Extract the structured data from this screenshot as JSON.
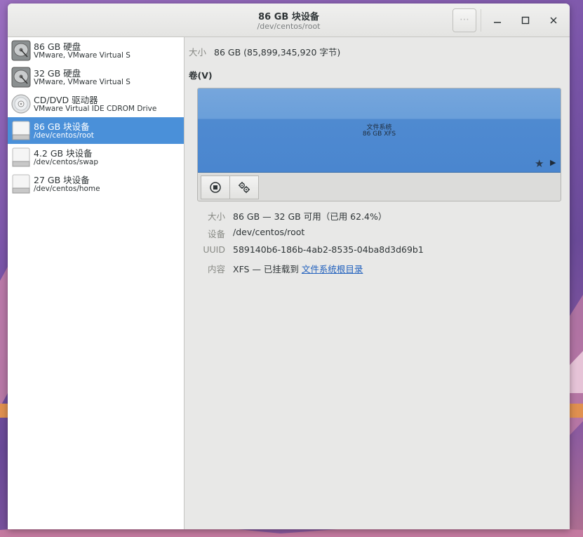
{
  "window": {
    "title": "86 GB 块设备",
    "subtitle": "/dev/centos/root",
    "menu_label": "⋯"
  },
  "sidebar": {
    "drives": [
      {
        "name": "86 GB 硬盘",
        "desc": "VMware, VMware Virtual S",
        "icon": "harddisk-icon",
        "selected": false
      },
      {
        "name": "32 GB 硬盘",
        "desc": "VMware, VMware Virtual S",
        "icon": "harddisk-icon",
        "selected": false
      },
      {
        "name": "CD/DVD 驱动器",
        "desc": "VMware Virtual IDE CDROM Drive",
        "icon": "optical-disc-icon",
        "selected": false
      },
      {
        "name": "86 GB 块设备",
        "desc": "/dev/centos/root",
        "icon": "block-device-icon",
        "selected": true
      },
      {
        "name": "4.2 GB 块设备",
        "desc": "/dev/centos/swap",
        "icon": "block-device-icon",
        "selected": false
      },
      {
        "name": "27 GB 块设备",
        "desc": "/dev/centos/home",
        "icon": "block-device-icon",
        "selected": false
      }
    ]
  },
  "main": {
    "size_label": "大小",
    "size_value": "86 GB (85,899,345,920 字节)",
    "volumes_heading": "卷(V)",
    "volume": {
      "title": "文件系统",
      "subtitle": "86 GB XFS"
    },
    "properties": [
      {
        "label": "大小",
        "value": "86 GB — 32 GB 可用（已用 62.4%）"
      },
      {
        "label": "设备",
        "value": "/dev/centos/root"
      },
      {
        "label": "UUID",
        "value": "589140b6-186b-4ab2-8535-04ba8d3d69b1"
      },
      {
        "label": "内容",
        "value": "XFS — 已挂载到 ",
        "link": "文件系统根目录"
      }
    ]
  },
  "colors": {
    "selection": "#4a90d9",
    "volume_bar": "#4a86cf",
    "link": "#1f5fbd"
  }
}
